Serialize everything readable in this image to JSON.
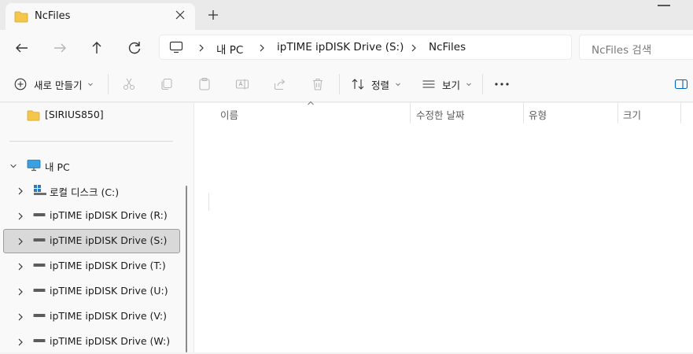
{
  "tab": {
    "title": "NcFiles"
  },
  "address": {
    "segments": [
      "내 PC",
      "ipTIME ipDISK Drive (S:)",
      "NcFiles"
    ]
  },
  "search": {
    "placeholder": "NcFiles 검색"
  },
  "toolbar": {
    "new_label": "새로 만들기",
    "sort_label": "정렬",
    "view_label": "보기"
  },
  "nav": {
    "quick_items": [
      {
        "label": "[SIRIUS850]",
        "icon": "folder-icon"
      }
    ],
    "this_pc": {
      "label": "내 PC",
      "icon": "monitor-icon"
    },
    "drives": [
      {
        "label": "로컬 디스크 (C:)",
        "icon": "windows-drive-icon"
      },
      {
        "label": "ipTIME ipDISK Drive (R:)",
        "icon": "network-drive-icon"
      },
      {
        "label": "ipTIME ipDISK Drive (S:)",
        "icon": "network-drive-icon",
        "selected": true
      },
      {
        "label": "ipTIME ipDISK Drive (T:)",
        "icon": "network-drive-icon"
      },
      {
        "label": "ipTIME ipDISK Drive (U:)",
        "icon": "network-drive-icon"
      },
      {
        "label": "ipTIME ipDISK Drive (V:)",
        "icon": "network-drive-icon"
      },
      {
        "label": "ipTIME ipDISK Drive (W:)",
        "icon": "network-drive-icon"
      }
    ]
  },
  "columns": [
    "이름",
    "수정한 날짜",
    "유형",
    "크기"
  ],
  "colors": {
    "folder": "#f4c64a",
    "accent": "#0067c0",
    "selected_bg": "#d9d9d9"
  }
}
